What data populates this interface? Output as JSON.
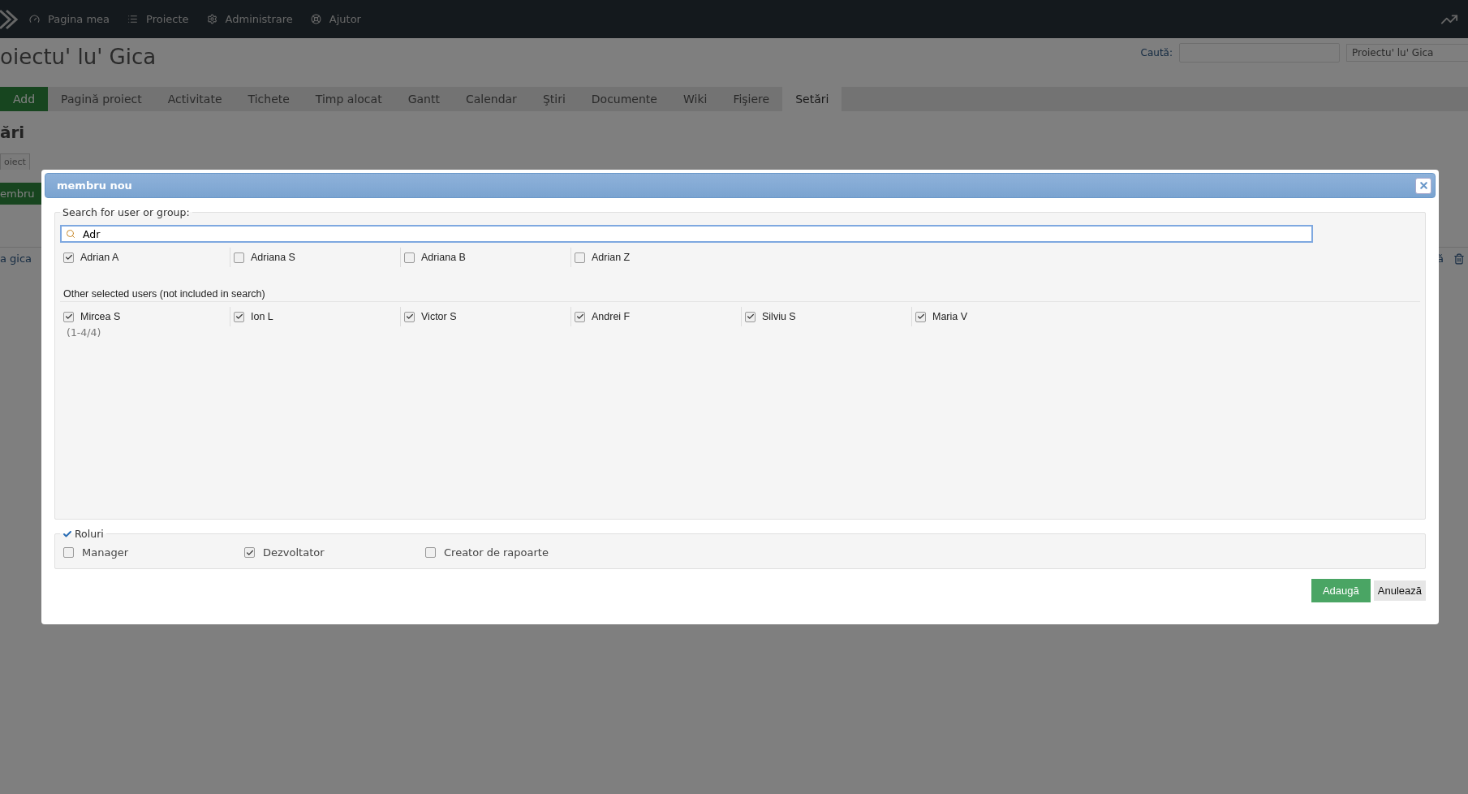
{
  "top_menu": [
    {
      "kind": "dashboard",
      "label": "Pagina mea"
    },
    {
      "kind": "list",
      "label": "Proiecte"
    },
    {
      "kind": "gear",
      "label": "Administrare"
    },
    {
      "kind": "help",
      "label": "Ajutor"
    }
  ],
  "search": {
    "label": "Caută:",
    "project": "Proiectu' lu' Gica"
  },
  "project_title": "oiectu' lu' Gica",
  "tabs": [
    {
      "label": "Add",
      "selected": false,
      "kind": "new"
    },
    {
      "label": "Pagină proiect",
      "selected": false
    },
    {
      "label": "Activitate",
      "selected": false
    },
    {
      "label": "Tichete",
      "selected": false
    },
    {
      "label": "Timp alocat",
      "selected": false
    },
    {
      "label": "Gantt",
      "selected": false
    },
    {
      "label": "Calendar",
      "selected": false
    },
    {
      "label": "Ştiri",
      "selected": false
    },
    {
      "label": "Documente",
      "selected": false
    },
    {
      "label": "Wiki",
      "selected": false
    },
    {
      "label": "Fişiere",
      "selected": false
    },
    {
      "label": "Setări",
      "selected": true
    }
  ],
  "settings_title": "ări",
  "settings_tab": "oiect",
  "new_member_button": "embru",
  "member_link": "a gica",
  "row_action": "ă",
  "dialog": {
    "title": "membru nou",
    "search_legend": "Search for user or group:",
    "search_value": "Adr",
    "results": [
      {
        "name": "Adrian A",
        "checked": true
      },
      {
        "name": "Adriana S",
        "checked": false
      },
      {
        "name": "Adriana B",
        "checked": false
      },
      {
        "name": "Adrian Z",
        "checked": false
      }
    ],
    "other_heading": "Other selected users (not included in search)",
    "other_users": [
      {
        "name": "Mircea S",
        "checked": true
      },
      {
        "name": "Ion L",
        "checked": true
      },
      {
        "name": "Victor S",
        "checked": true
      },
      {
        "name": "Andrei F",
        "checked": true
      },
      {
        "name": "Silviu S",
        "checked": true
      },
      {
        "name": "Maria V",
        "checked": true
      }
    ],
    "count": "(1-4/4)",
    "roles_legend": "Roluri",
    "roles": [
      {
        "name": "Manager",
        "checked": false
      },
      {
        "name": "Dezvoltator",
        "checked": true
      },
      {
        "name": "Creator de rapoarte",
        "checked": false
      }
    ],
    "buttons": [
      {
        "kind": "primary",
        "label": "Adaugă"
      },
      {
        "kind": "secondary",
        "label": "Anulează"
      }
    ]
  }
}
